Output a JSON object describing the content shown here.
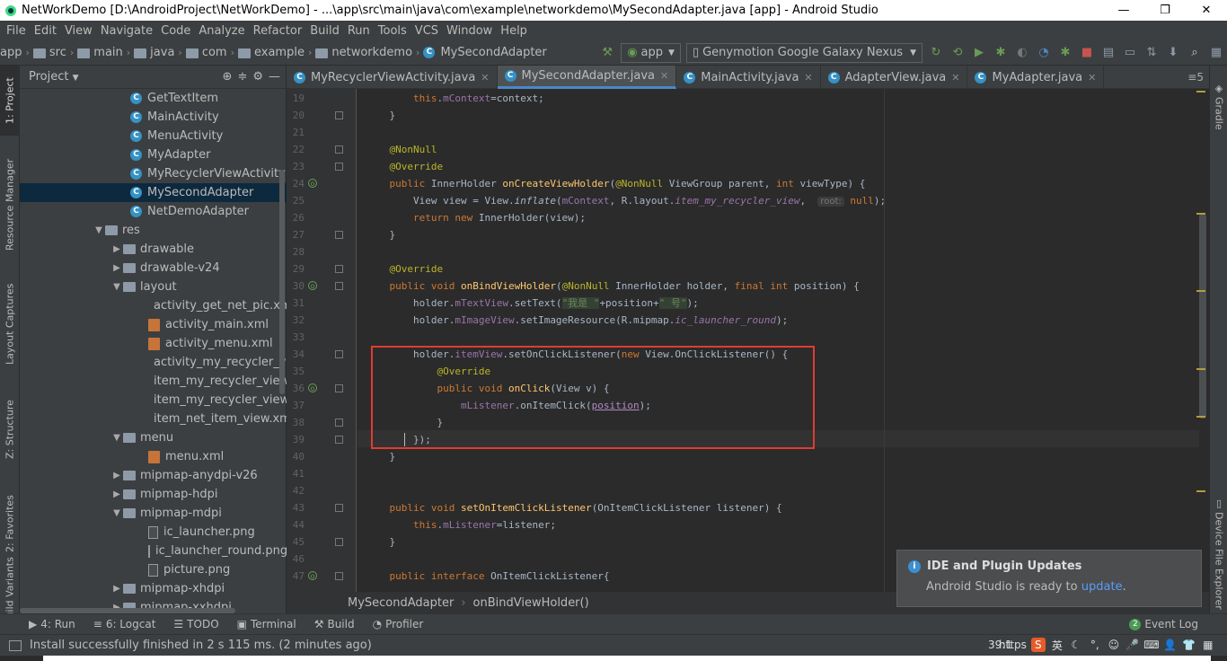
{
  "window": {
    "title": "NetWorkDemo [D:\\AndroidProject\\NetWorkDemo] - ...\\app\\src\\main\\java\\com\\example\\networkdemo\\MySecondAdapter.java [app] - Android Studio",
    "minimize": "—",
    "maximize": "❐",
    "close": "✕"
  },
  "menu": [
    "File",
    "Edit",
    "View",
    "Navigate",
    "Code",
    "Analyze",
    "Refactor",
    "Build",
    "Run",
    "Tools",
    "VCS",
    "Window",
    "Help"
  ],
  "breadcrumbs": [
    "app",
    "src",
    "main",
    "java",
    "com",
    "example",
    "networkdemo",
    "MySecondAdapter"
  ],
  "toolbar": {
    "run_config": "app",
    "device": "Genymotion Google Galaxy Nexus"
  },
  "left_tabs": [
    "1: Project",
    "Resource Manager",
    "Layout Captures",
    "Z: Structure",
    "2: Favorites",
    "Build Variants"
  ],
  "right_tabs": [
    "Gradle",
    "Device File Explorer"
  ],
  "project_panel": {
    "title": "Project",
    "tree": [
      {
        "label": "GetTextItem",
        "type": "class",
        "indent": 1
      },
      {
        "label": "MainActivity",
        "type": "class",
        "indent": 1
      },
      {
        "label": "MenuActivity",
        "type": "class",
        "indent": 1
      },
      {
        "label": "MyAdapter",
        "type": "class",
        "indent": 1
      },
      {
        "label": "MyRecyclerViewActivity",
        "type": "class",
        "indent": 1
      },
      {
        "label": "MySecondAdapter",
        "type": "class",
        "indent": 1,
        "selected": true
      },
      {
        "label": "NetDemoAdapter",
        "type": "class",
        "indent": 1
      },
      {
        "label": "res",
        "type": "folder",
        "indent": 0,
        "open": true
      },
      {
        "label": "drawable",
        "type": "folder",
        "indent": 1,
        "open": false
      },
      {
        "label": "drawable-v24",
        "type": "folder",
        "indent": 1,
        "open": false
      },
      {
        "label": "layout",
        "type": "folder",
        "indent": 1,
        "open": true
      },
      {
        "label": "activity_get_net_pic.xml",
        "type": "xml",
        "indent": 2
      },
      {
        "label": "activity_main.xml",
        "type": "xml",
        "indent": 2
      },
      {
        "label": "activity_menu.xml",
        "type": "xml",
        "indent": 2
      },
      {
        "label": "activity_my_recycler_view.x",
        "type": "xml",
        "indent": 2
      },
      {
        "label": "item_my_recycler_view.xml",
        "type": "xml",
        "indent": 2
      },
      {
        "label": "item_my_recycler_view_loa",
        "type": "xml",
        "indent": 2
      },
      {
        "label": "item_net_item_view.xml",
        "type": "xml",
        "indent": 2
      },
      {
        "label": "menu",
        "type": "folder",
        "indent": 1,
        "open": true
      },
      {
        "label": "menu.xml",
        "type": "xml",
        "indent": 2
      },
      {
        "label": "mipmap-anydpi-v26",
        "type": "folder",
        "indent": 1,
        "open": false
      },
      {
        "label": "mipmap-hdpi",
        "type": "folder",
        "indent": 1,
        "open": false
      },
      {
        "label": "mipmap-mdpi",
        "type": "folder",
        "indent": 1,
        "open": true
      },
      {
        "label": "ic_launcher.png",
        "type": "png",
        "indent": 2
      },
      {
        "label": "ic_launcher_round.png",
        "type": "png",
        "indent": 2
      },
      {
        "label": "picture.png",
        "type": "png",
        "indent": 2
      },
      {
        "label": "mipmap-xhdpi",
        "type": "folder",
        "indent": 1,
        "open": false
      },
      {
        "label": "mipmap-xxhdpi",
        "type": "folder",
        "indent": 1,
        "open": false
      }
    ]
  },
  "editor_tabs": [
    {
      "label": "MyRecyclerViewActivity.java",
      "active": false
    },
    {
      "label": "MySecondAdapter.java",
      "active": true
    },
    {
      "label": "MainActivity.java",
      "active": false
    },
    {
      "label": "AdapterView.java",
      "active": false
    },
    {
      "label": "MyAdapter.java",
      "active": false
    }
  ],
  "editor_tabs_menu": "≡5",
  "line_numbers": [
    "19",
    "20",
    "21",
    "22",
    "23",
    "24",
    "25",
    "26",
    "27",
    "28",
    "29",
    "30",
    "31",
    "32",
    "33",
    "34",
    "35",
    "36",
    "37",
    "38",
    "39",
    "40",
    "41",
    "42",
    "43",
    "44",
    "45",
    "46",
    "47"
  ],
  "code_lines": [
    "        <span class=\"kw\">this</span>.<span class=\"fld\">mContext</span>=context;",
    "    }",
    "",
    "    <span class=\"ann\">@NonNull</span>",
    "    <span class=\"ann\">@Override</span>",
    "    <span class=\"kw\">public</span> InnerHolder <span class=\"fn\">onCreateViewHolder</span>(<span class=\"ann\">@NonNull</span> ViewGroup parent, <span class=\"kw\">int</span> viewType) {",
    "        View view = View.<span class=\"ital\">inflate</span>(<span class=\"fld\">mContext</span>, R.layout.<span class=\"fld ital\">item_my_recycler_view</span>,  <span class=\"hint\">root:</span> <span class=\"kw\">null</span>);",
    "        <span class=\"kw\">return new</span> InnerHolder(view);",
    "    }",
    "",
    "    <span class=\"ann\">@Override</span>",
    "    <span class=\"kw\">public void</span> <span class=\"fn\">onBindViewHolder</span>(<span class=\"ann\">@NonNull</span> InnerHolder holder, <span class=\"kw\">final int</span> position) {",
    "        holder.<span class=\"fld\">mTextView</span>.setText(<span class=\"str\">\"我是 \"</span>+position+<span class=\"str\">\" 号\"</span>);",
    "        holder.<span class=\"fld\">mImageView</span>.setImageResource(R.mipmap.<span class=\"fld ital\">ic_launcher_round</span>);",
    "",
    "        holder.<span class=\"fld\">itemView</span>.setOnClickListener(<span class=\"kw\">new</span> View.OnClickListener() {",
    "            <span class=\"ann\">@Override</span>",
    "            <span class=\"kw\">public void</span> <span class=\"fn\">onClick</span>(View v) {",
    "                <span class=\"fld\">mListener</span>.onItemClick(<span class=\"param\">position</span>);",
    "            }",
    "        });",
    "    }",
    "",
    "",
    "    <span class=\"kw\">public void</span> <span class=\"fn\">setOnItemClickListener</span>(OnItemClickListener listener) {",
    "        <span class=\"kw\">this</span>.<span class=\"fld\">mListener</span>=listener;",
    "    }",
    "",
    "    <span class=\"kw\">public interface</span> OnItemClickListener{"
  ],
  "code_breadcrumb": [
    "MySecondAdapter",
    "onBindViewHolder()"
  ],
  "tool_windows": [
    {
      "label": "4: Run",
      "icon": "▶"
    },
    {
      "label": "6: Logcat",
      "icon": "≡"
    },
    {
      "label": "TODO",
      "icon": "☰"
    },
    {
      "label": "Terminal",
      "icon": "▣"
    },
    {
      "label": "Build",
      "icon": "⚒"
    },
    {
      "label": "Profiler",
      "icon": "◔"
    }
  ],
  "event_log": "Event Log",
  "event_log_count": "2",
  "status": {
    "message": "Install successfully finished in 2 s 115 ms. (2 minutes ago)",
    "position": "39:1",
    "tray_text": "https",
    "tray_lang": "英"
  },
  "notification": {
    "title": "IDE and Plugin Updates",
    "body": "Android Studio is ready to ",
    "link": "update",
    "end": "."
  },
  "colors": {
    "accent": "#4a88c7",
    "highlight_box": "#e03c31"
  }
}
